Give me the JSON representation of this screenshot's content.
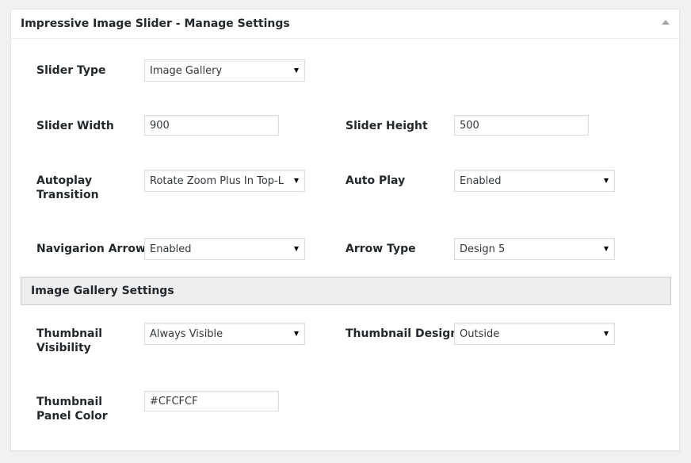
{
  "panel": {
    "title": "Impressive Image Slider - Manage Settings"
  },
  "fields": {
    "slider_type": {
      "label": "Slider Type",
      "value": "Image Gallery"
    },
    "slider_width": {
      "label": "Slider Width",
      "value": "900"
    },
    "slider_height": {
      "label": "Slider Height",
      "value": "500"
    },
    "autoplay_transition": {
      "label": "Autoplay Transition",
      "value": "Rotate Zoom Plus In Top-L"
    },
    "auto_play": {
      "label": "Auto Play",
      "value": "Enabled"
    },
    "navigation_arrows": {
      "label": "Navigarion Arrows",
      "value": "Enabled"
    },
    "arrow_type": {
      "label": "Arrow Type",
      "value": "Design 5"
    }
  },
  "gallery_section": {
    "title": "Image Gallery Settings",
    "thumbnail_visibility": {
      "label": "Thumbnail Visibility",
      "value": "Always Visible"
    },
    "thumbnail_design": {
      "label": "Thumbnail Design",
      "value": "Outside"
    },
    "thumbnail_panel_color": {
      "label": "Thumbnail Panel Color",
      "value": "#CFCFCF"
    }
  }
}
